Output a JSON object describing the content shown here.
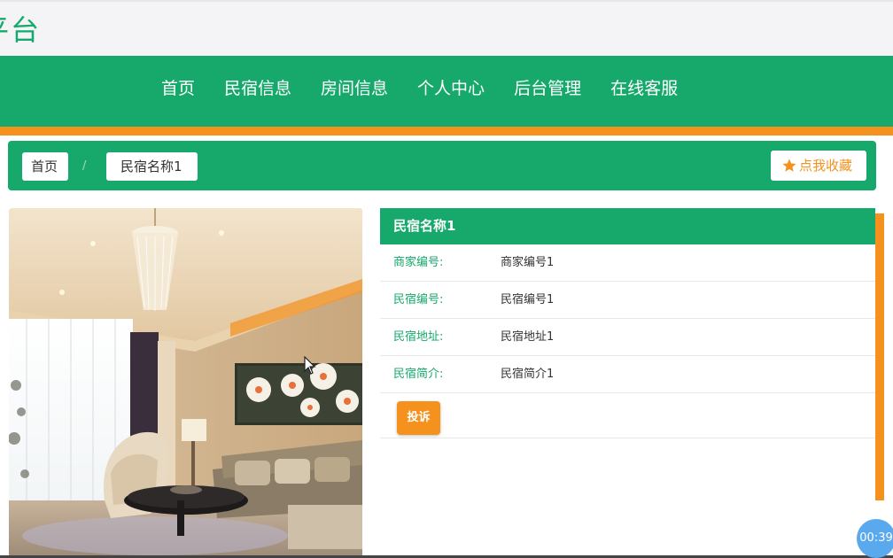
{
  "site": {
    "title": "平台"
  },
  "nav": {
    "items": [
      {
        "label": "首页"
      },
      {
        "label": "民宿信息"
      },
      {
        "label": "房间信息"
      },
      {
        "label": "个人中心"
      },
      {
        "label": "后台管理"
      },
      {
        "label": "在线客服"
      }
    ]
  },
  "breadcrumb": {
    "home": "首页",
    "separator": "/",
    "current": "民宿名称1"
  },
  "favorite": {
    "label": "点我收藏",
    "icon": "star-icon"
  },
  "detail": {
    "title": "民宿名称1",
    "rows": [
      {
        "label": "商家编号:",
        "value": "商家编号1"
      },
      {
        "label": "民宿编号:",
        "value": "民宿编号1"
      },
      {
        "label": "民宿地址:",
        "value": "民宿地址1"
      },
      {
        "label": "民宿简介:",
        "value": "民宿简介1"
      }
    ],
    "complain_label": "投诉"
  },
  "timer": {
    "text": "00:39"
  },
  "colors": {
    "brand_green": "#16a96b",
    "accent_orange": "#f5921e"
  }
}
